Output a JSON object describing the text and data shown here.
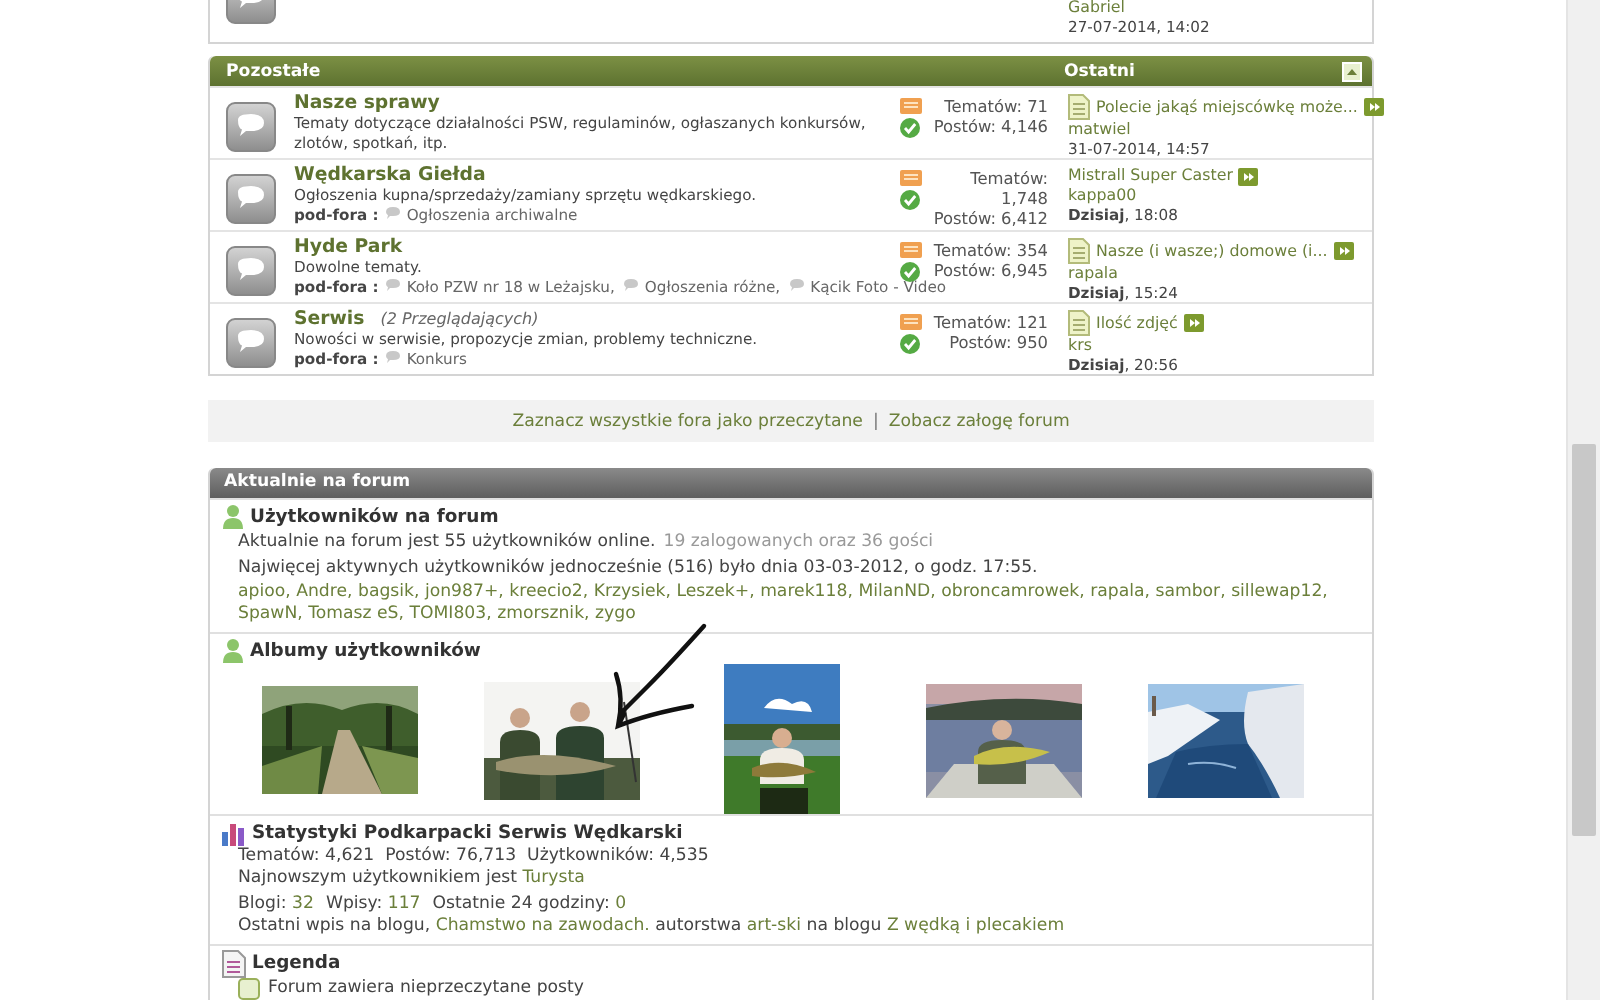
{
  "top_forum": {
    "last_post": {
      "author": "Gabriel",
      "date": "27-07-2014, 14:02"
    }
  },
  "category": {
    "title": "Pozostałe",
    "last_header": "Ostatni",
    "forums": [
      {
        "title": "Nasze sprawy",
        "description": "Tematy dotyczące działalności PSW, regulaminów, ogłaszanych konkursów, zlotów, spotkań, itp.",
        "topics": "Tematów: 71",
        "posts": "Postów: 4,146",
        "last_post": {
          "kind": "topic",
          "title": "Polecie jakąś miejscówkę może...",
          "author": "matwiel",
          "date": "31-07-2014, 14:57"
        }
      },
      {
        "title": "Wędkarska Giełda",
        "description": "Ogłoszenia kupna/sprzedaży/zamiany sprzętu wędkarskiego.",
        "subforums_label": "pod-fora :",
        "subforums": [
          "Ogłoszenia archiwalne"
        ],
        "topics": "Tematów: 1,748",
        "posts": "Postów: 6,412",
        "last_post": {
          "kind": "plain",
          "title": "Mistrall Super Caster",
          "author": "kappa00",
          "date": "**Dzisiaj**, 18:08"
        }
      },
      {
        "title": "Hyde Park",
        "description": "Dowolne tematy.",
        "subforums_label": "pod-fora :",
        "subforums": [
          "Koło PZW nr 18 w Leżajsku,",
          "Ogłoszenia różne,",
          "Kącik Foto - Video"
        ],
        "topics": "Tematów: 354",
        "posts": "Postów: 6,945",
        "last_post": {
          "kind": "topic",
          "title": "Nasze (i wasze;) domowe (i...",
          "author": "rapala",
          "date": "**Dzisiaj**, 15:24"
        }
      },
      {
        "title": "Serwis",
        "viewers": "(2 Przeglądających)",
        "description": "Nowości w serwisie, propozycje zmian, problemy techniczne.",
        "subforums_label": "pod-fora :",
        "subforums": [
          "Konkurs"
        ],
        "topics": "Tematów: 121",
        "posts": "Postów: 950",
        "last_post": {
          "kind": "topic",
          "title": "Ilość zdjęć",
          "author": "krs",
          "date": "**Dzisiaj**, 20:56"
        }
      }
    ]
  },
  "actions": [
    "Zaznacz wszystkie fora jako przeczytane",
    "|",
    "Zobacz załogę forum"
  ],
  "online": {
    "title": "Aktualnie na forum",
    "users": {
      "title": "Użytkowników na forum",
      "count_text": "Aktualnie na forum jest 55 użytkowników online.",
      "detail_text": "19 zalogowanych oraz 36 gości",
      "record_text": "Najwięcej aktywnych użytkowników jednocześnie (516) było dnia 03-03-2012, o godz. 17:55.",
      "names": [
        "apioo,",
        "Andre,",
        "bagsik,",
        "jon987+,",
        "kreecio2,",
        "Krzysiek,",
        "Leszek+,",
        "marek118,",
        "MilanND,",
        "obroncamrowek,",
        "rapala,",
        "sambor,",
        "sillewap12,",
        "SpawN,",
        "Tomasz eS,",
        "TOMI803,",
        "zmorsznik,",
        "zygo"
      ]
    },
    "albums": {
      "title": "Albumy użytkowników",
      "annotation": {
        "kind": "arrow"
      }
    },
    "stats": {
      "title": "Statystyki Podkarpacki Serwis Wędkarski",
      "totals": "Tematów: 4,621  Postów: 76,713  Użytkowników: 4,535",
      "newest": [
        {
          "text": "Najnowszym użytkownikiem jest ",
          "link": false
        },
        {
          "text": "Turysta",
          "link": true
        }
      ],
      "blog_counts": [
        {
          "label": "Blogi:",
          "value": "32"
        },
        {
          "label": "Wpisy:",
          "value": "117"
        },
        {
          "label": "Ostatnie 24 godziny:",
          "value": "0"
        }
      ],
      "last_entry": [
        {
          "text": "Ostatni wpis na blogu, ",
          "link": false
        },
        {
          "text": "Chamstwo na zawodach.",
          "link": true
        },
        {
          "text": " autorstwa ",
          "link": false
        },
        {
          "text": "art-ski",
          "link": true
        },
        {
          "text": " na blogu ",
          "link": false
        },
        {
          "text": "Z wędką i plecakiem",
          "link": true
        }
      ]
    },
    "legend": {
      "title": "Legenda",
      "items": [
        "Forum zawiera nieprzeczytane posty"
      ]
    }
  }
}
